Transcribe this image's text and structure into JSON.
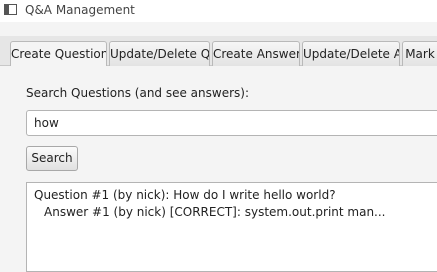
{
  "window": {
    "title": "Q&A Management"
  },
  "tabs": [
    {
      "label": "Create Question",
      "active": true
    },
    {
      "label": "Update/Delete Q",
      "active": false
    },
    {
      "label": "Create Answer",
      "active": false
    },
    {
      "label": "Update/Delete A",
      "active": false
    },
    {
      "label": "Mark",
      "active": false
    }
  ],
  "search": {
    "label": "Search Questions (and see answers):",
    "value": "how",
    "button_label": "Search"
  },
  "results": {
    "lines": [
      "Question #1 (by nick): How do I write hello world?",
      "Answer #1 (by nick) [CORRECT]: system.out.print man..."
    ]
  }
}
